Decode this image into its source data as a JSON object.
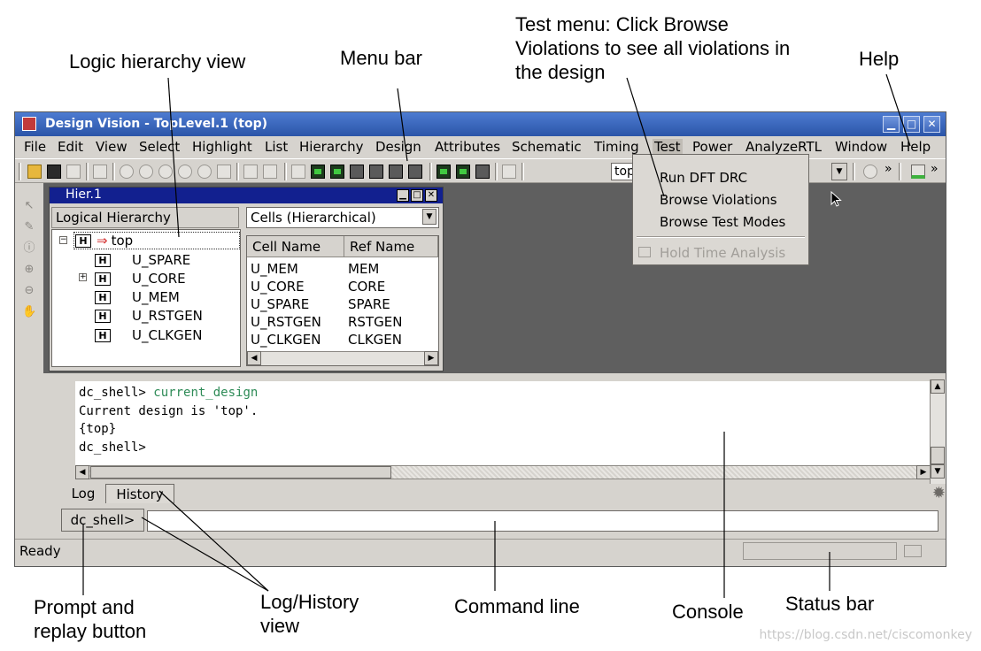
{
  "annotations": {
    "logic_hierarchy": "Logic hierarchy view",
    "menu_bar": "Menu bar",
    "test_menu_lines": [
      "Test menu: Click Browse",
      "Violations to see all violations in",
      "the design"
    ],
    "help": "Help",
    "prompt_lines": [
      "Prompt and",
      "replay button"
    ],
    "log_history_lines": [
      "Log/History",
      "view"
    ],
    "command_line": "Command line",
    "console": "Console",
    "status_bar": "Status bar"
  },
  "window": {
    "title": "Design Vision - TopLevel.1 (top)",
    "controls": [
      "minimize-icon",
      "maximize-icon",
      "close-icon"
    ]
  },
  "menubar": {
    "items": [
      "File",
      "Edit",
      "View",
      "Select",
      "Highlight",
      "List",
      "Hierarchy",
      "Design",
      "Attributes",
      "Schematic",
      "Timing",
      "Test",
      "Power",
      "AnalyzeRTL",
      "Window",
      "Help"
    ],
    "active": "Test"
  },
  "toolbar": {
    "design_selector_value": "top",
    "icons": [
      "open-folder-icon",
      "save-icon",
      "print-icon",
      "zoom-in-icon",
      "zoom-out-icon",
      "schematic-icon",
      "symbol-icon",
      "run-icon"
    ]
  },
  "hier_window": {
    "title": "Hier.1",
    "left_header": "Logical Hierarchy",
    "tree": {
      "root": {
        "badge": "H",
        "label": "top"
      },
      "children": [
        {
          "badge": "H",
          "label": "U_SPARE"
        },
        {
          "badge": "H",
          "label": "U_CORE"
        },
        {
          "badge": "H",
          "label": "U_MEM"
        },
        {
          "badge": "H",
          "label": "U_RSTGEN"
        },
        {
          "badge": "H",
          "label": "U_CLKGEN"
        }
      ]
    },
    "cells_dropdown": "Cells (Hierarchical)",
    "columns": [
      "Cell Name",
      "Ref Name"
    ],
    "rows": [
      [
        "U_MEM",
        "MEM"
      ],
      [
        "U_CORE",
        "CORE"
      ],
      [
        "U_SPARE",
        "SPARE"
      ],
      [
        "U_RSTGEN",
        "RSTGEN"
      ],
      [
        "U_CLKGEN",
        "CLKGEN"
      ]
    ]
  },
  "test_menu": {
    "items": [
      "Run DFT DRC",
      "Browse Violations",
      "Browse Test Modes"
    ],
    "disabled_item": "Hold Time Analysis"
  },
  "console": {
    "lines": [
      {
        "prompt": "dc_shell> ",
        "cmd": "current_design"
      },
      {
        "text": "Current design is 'top'."
      },
      {
        "text": "{top}"
      },
      {
        "prompt": "dc_shell>",
        "cmd": ""
      }
    ]
  },
  "tabs": [
    "Log",
    "History"
  ],
  "active_tab": "Log",
  "prompt_button": "dc_shell>",
  "command_input_value": "",
  "status": "Ready",
  "watermark": "https://blog.csdn.net/ciscomonkey"
}
